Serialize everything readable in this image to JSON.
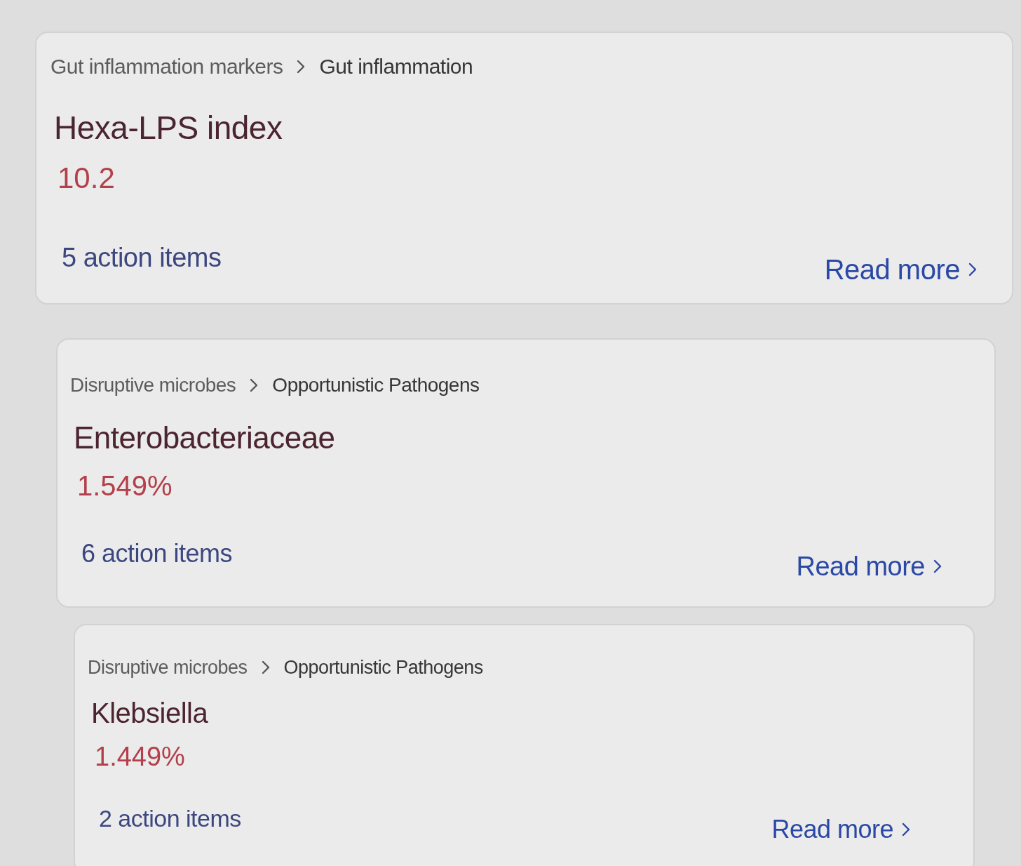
{
  "cards": [
    {
      "breadcrumb": [
        "Gut inflammation markers",
        "Gut inflammation"
      ],
      "title": "Hexa-LPS index",
      "value": "10.2",
      "action_items": "5 action items",
      "link": "Read more"
    },
    {
      "breadcrumb": [
        "Disruptive microbes",
        "Opportunistic Pathogens"
      ],
      "title": "Enterobacteriaceae",
      "value": "1.549%",
      "action_items": "6 action items",
      "link": "Read more"
    },
    {
      "breadcrumb": [
        "Disruptive microbes",
        "Opportunistic Pathogens"
      ],
      "title": "Klebsiella",
      "value": "1.449%",
      "action_items": "2 action items",
      "link": "Read more"
    }
  ]
}
